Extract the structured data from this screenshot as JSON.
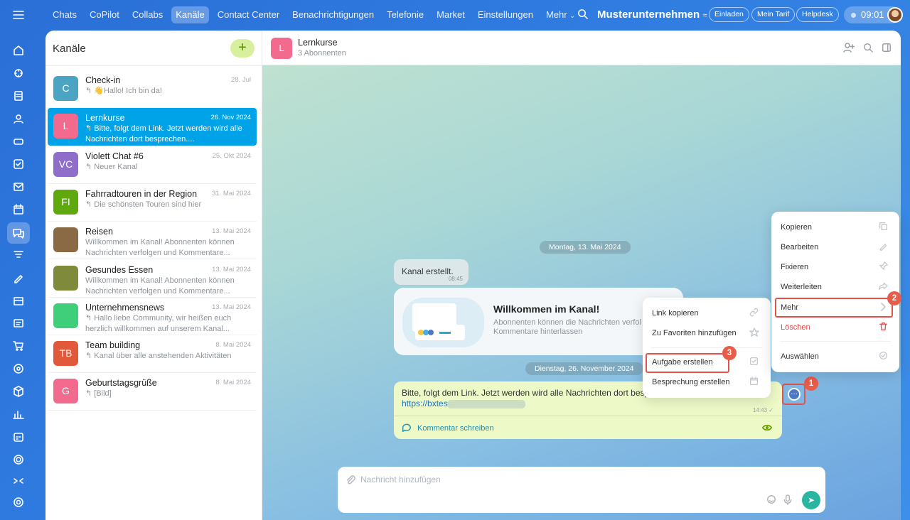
{
  "topnav": {
    "items": [
      "Chats",
      "CoPilot",
      "Collabs",
      "Kanäle",
      "Contact Center",
      "Benachrichtigungen",
      "Telefonie",
      "Market",
      "Einstellungen",
      "Mehr"
    ],
    "active": "Kanäle",
    "company": "Musterunternehmen",
    "invite": "Einladen",
    "plan": "Mein Tarif",
    "helpdesk": "Helpdesk",
    "time": "09:01"
  },
  "list": {
    "title": "Kanäle",
    "add": "+",
    "items": [
      {
        "initials": "C",
        "name": "Check-in",
        "date": "28. Jul",
        "preview": "↰ 👋Hallo! Ich bin da!",
        "color": "#4ba5c2"
      },
      {
        "initials": "L",
        "name": "Lernkurse",
        "date": "26. Nov 2024",
        "preview": "↰ Bitte, folgt dem Link. Jetzt werden wird alle Nachrichten dort besprechen....",
        "color": "#f26a8d"
      },
      {
        "initials": "VC",
        "name": "Violett Chat #6",
        "date": "25. Okt 2024",
        "preview": "↰ Neuer Kanal",
        "color": "#8e6ec8"
      },
      {
        "initials": "FI",
        "name": "Fahrradtouren in der Region",
        "date": "31. Mai 2024",
        "preview": "↰ Die schönsten Touren sind hier",
        "color": "#5fa80d"
      },
      {
        "initials": "",
        "name": "Reisen",
        "date": "13. Mai 2024",
        "preview": "Willkommen im Kanal! Abonnenten können Nachrichten verfolgen und Kommentare...",
        "color": "#8a6a45"
      },
      {
        "initials": "",
        "name": "Gesundes Essen",
        "date": "13. Mai 2024",
        "preview": "Willkommen im Kanal! Abonnenten können Nachrichten verfolgen und Kommentare...",
        "color": "#7f8a3a"
      },
      {
        "initials": "",
        "name": "Unternehmensnews",
        "date": "13. Mai 2024",
        "preview": "↰ Hallo liebe Community, wir heißen euch herzlich willkommen auf unserem Kanal...",
        "color": "#3fcf7a"
      },
      {
        "initials": "TB",
        "name": "Team building",
        "date": "8. Mai 2024",
        "preview": "↰ Kanal über alle anstehenden Aktivitäten",
        "color": "#e2583a"
      },
      {
        "initials": "G",
        "name": "Geburtstagsgrüße",
        "date": "8. Mai 2024",
        "preview": "↰ [Bild]",
        "color": "#f26a8d"
      }
    ]
  },
  "chat": {
    "initial": "L",
    "title": "Lernkurse",
    "subtitle": "3 Abonnenten",
    "date1": "Montag, 13. Mai 2024",
    "date2": "Dienstag, 26. November 2024",
    "system_text": "Kanal erstellt.",
    "system_time": "08:45",
    "welcome_title": "Willkommen im Kanal!",
    "welcome_desc": "Abonnenten können die Nachrichten verfol Kommentare hinterlassen",
    "message_text": "Bitte, folgt dem Link. Jetzt werden wird alle Nachrichten dort besp",
    "message_link": "https://bxtes",
    "message_time": "14:43 ✓",
    "comment": "Kommentar schreiben",
    "input_placeholder": "Nachricht hinzufügen"
  },
  "context_menu": {
    "items": [
      "Kopieren",
      "Bearbeiten",
      "Fixieren",
      "Weiterleiten",
      "Mehr",
      "Löschen",
      "Auswählen"
    ]
  },
  "submenu": {
    "items": [
      "Link kopieren",
      "Zu Favoriten hinzufügen",
      "Aufgabe erstellen",
      "Besprechung erstellen"
    ]
  },
  "badges": [
    "1",
    "2",
    "3"
  ]
}
